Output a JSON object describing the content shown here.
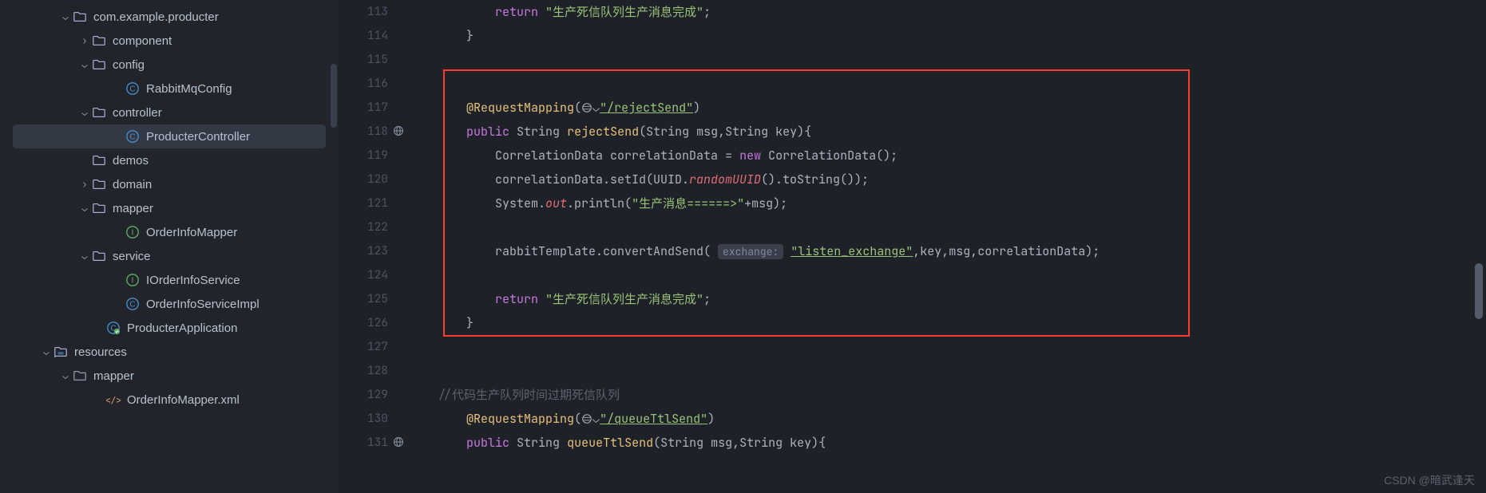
{
  "tree": [
    {
      "indent": 74,
      "chev": "down",
      "icon": "folder",
      "label": "com.example.producter"
    },
    {
      "indent": 98,
      "chev": "right",
      "icon": "folder",
      "label": "component"
    },
    {
      "indent": 98,
      "chev": "down",
      "icon": "folder",
      "label": "config"
    },
    {
      "indent": 140,
      "chev": "",
      "icon": "class-c",
      "label": "RabbitMqConfig"
    },
    {
      "indent": 98,
      "chev": "down",
      "icon": "folder",
      "label": "controller"
    },
    {
      "indent": 140,
      "chev": "",
      "icon": "class-c",
      "label": "ProducterController",
      "selected": true
    },
    {
      "indent": 98,
      "chev": "",
      "icon": "folder",
      "label": "demos"
    },
    {
      "indent": 98,
      "chev": "right",
      "icon": "folder",
      "label": "domain"
    },
    {
      "indent": 98,
      "chev": "down",
      "icon": "folder",
      "label": "mapper"
    },
    {
      "indent": 140,
      "chev": "",
      "icon": "class-i",
      "label": "OrderInfoMapper"
    },
    {
      "indent": 98,
      "chev": "down",
      "icon": "folder",
      "label": "service"
    },
    {
      "indent": 140,
      "chev": "",
      "icon": "class-i",
      "label": "IOrderInfoService"
    },
    {
      "indent": 140,
      "chev": "",
      "icon": "class-c",
      "label": "OrderInfoServiceImpl"
    },
    {
      "indent": 116,
      "chev": "",
      "icon": "class-s",
      "label": "ProducterApplication"
    },
    {
      "indent": 50,
      "chev": "down",
      "icon": "res",
      "label": "resources"
    },
    {
      "indent": 74,
      "chev": "down",
      "icon": "folder-plain",
      "label": "mapper"
    },
    {
      "indent": 116,
      "chev": "",
      "icon": "xml",
      "label": "OrderInfoMapper.xml"
    }
  ],
  "gutter": [
    "113",
    "114",
    "115",
    "116",
    "117",
    "118",
    "119",
    "120",
    "121",
    "122",
    "123",
    "124",
    "125",
    "126",
    "127",
    "128",
    "129",
    "130",
    "131"
  ],
  "code": {
    "l113_return": "return",
    "l113_str": "\"生产死信队列生产消息完成\"",
    "l117_ann": "@RequestMapping",
    "l117_path": "\"/rejectSend\"",
    "l118_pub": "public",
    "l118_type": "String",
    "l118_name": "rejectSend",
    "l118_params": "(String msg,String key){",
    "l119_type": "CorrelationData",
    "l119_var": "correlationData",
    "l119_new": "new",
    "l119_ctor": "CorrelationData()",
    "l120_call": "correlationData.setId(UUID.",
    "l120_rand": "randomUUID",
    "l120_tail": "().toString());",
    "l121_sys": "System.",
    "l121_out": "out",
    "l121_print": ".println(",
    "l121_str": "\"生产消息======>\"",
    "l121_tail": "+msg);",
    "l123_tpl": "rabbitTemplate.convertAndSend(",
    "l123_hint": "exchange:",
    "l123_str": "\"listen_exchange\"",
    "l123_tail": ",key,msg,correlationData);",
    "l125_return": "return",
    "l125_str": "\"生产死信队列生产消息完成\"",
    "l129_comment": "//代码生产队列时间过期死信队列",
    "l130_ann": "@RequestMapping",
    "l130_path": "\"/queueTtlSend\"",
    "l131_pub": "public",
    "l131_type": "String",
    "l131_name": "queueTtlSend",
    "l131_params": "(String msg,String key){"
  },
  "watermark": "CSDN @暗武逢天"
}
